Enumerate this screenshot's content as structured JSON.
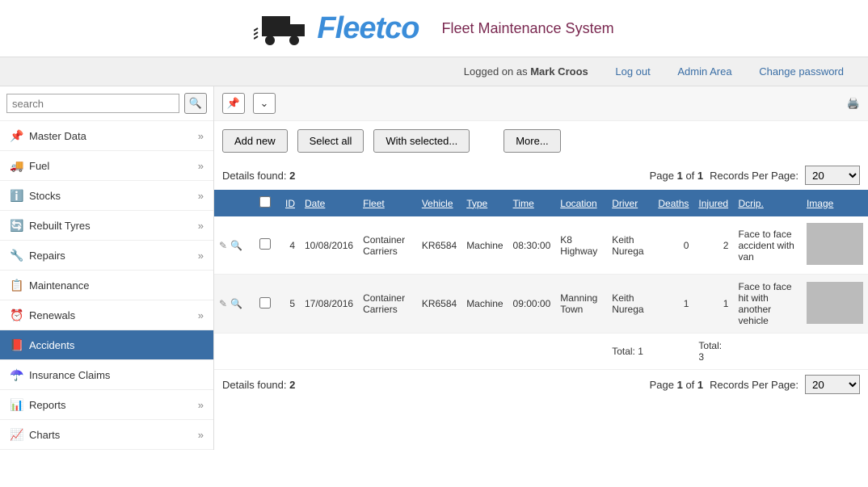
{
  "header": {
    "logo": "Fleetco",
    "subtitle": "Fleet Maintenance System"
  },
  "topbar": {
    "logged_on_label": "Logged on as",
    "user": "Mark Croos",
    "logout": "Log out",
    "admin": "Admin Area",
    "changepw": "Change password"
  },
  "search": {
    "placeholder": "search"
  },
  "sidebar": {
    "items": [
      {
        "label": "Master Data",
        "icon": "📌",
        "expandable": true
      },
      {
        "label": "Fuel",
        "icon": "🚚",
        "expandable": true
      },
      {
        "label": "Stocks",
        "icon": "ℹ️",
        "expandable": true
      },
      {
        "label": "Rebuilt Tyres",
        "icon": "🔄",
        "expandable": true
      },
      {
        "label": "Repairs",
        "icon": "🔧",
        "expandable": true
      },
      {
        "label": "Maintenance",
        "icon": "📋",
        "expandable": false
      },
      {
        "label": "Renewals",
        "icon": "⏰",
        "expandable": true
      },
      {
        "label": "Accidents",
        "icon": "📕",
        "expandable": false,
        "active": true
      },
      {
        "label": "Insurance Claims",
        "icon": "☂️",
        "expandable": false
      },
      {
        "label": "Reports",
        "icon": "📊",
        "expandable": true
      },
      {
        "label": "Charts",
        "icon": "📈",
        "expandable": true
      }
    ]
  },
  "actions": {
    "add": "Add new",
    "select_all": "Select all",
    "with_selected": "With selected...",
    "more": "More..."
  },
  "details": {
    "found_label": "Details found:",
    "found_count": "2",
    "page_label": "Page",
    "page_current": "1",
    "page_of": "of",
    "page_total": "1",
    "rpp_label": "Records Per Page:",
    "rpp_value": "20"
  },
  "table": {
    "headers": {
      "id": "ID",
      "date": "Date",
      "fleet": "Fleet",
      "vehicle": "Vehicle",
      "type": "Type",
      "time": "Time",
      "location": "Location",
      "driver": "Driver",
      "deaths": "Deaths",
      "injured": "Injured",
      "descrip": "Dcrip.",
      "image": "Image"
    },
    "rows": [
      {
        "id": "4",
        "date": "10/08/2016",
        "fleet": "Container Carriers",
        "vehicle": "KR6584",
        "type": "Machine",
        "time": "08:30:00",
        "location": "K8 Highway",
        "driver": "Keith Nurega",
        "deaths": "0",
        "injured": "2",
        "descrip": "Face to face accident with van"
      },
      {
        "id": "5",
        "date": "17/08/2016",
        "fleet": "Container Carriers",
        "vehicle": "KR6584",
        "type": "Machine",
        "time": "09:00:00",
        "location": "Manning Town",
        "driver": "Keith Nurega",
        "deaths": "1",
        "injured": "1",
        "descrip": "Face to face hit with another vehicle"
      }
    ],
    "totals": {
      "deaths_label": "Total:",
      "deaths": "1",
      "injured_label": "Total:",
      "injured": "3"
    }
  }
}
